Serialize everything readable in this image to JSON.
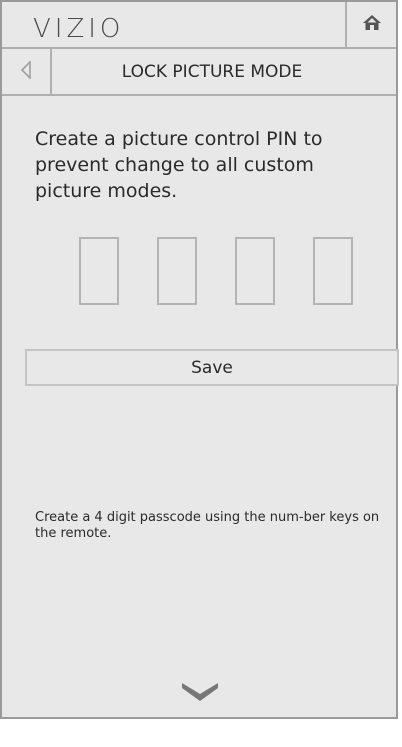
{
  "header": {
    "logo_text": "VIZIO",
    "home_icon": "home-icon"
  },
  "titlebar": {
    "back_icon": "back-arrow-icon",
    "title": "LOCK PICTURE MODE"
  },
  "main": {
    "description": "Create a picture control PIN to prevent change to all custom picture modes.",
    "pin_digits": [
      "",
      "",
      "",
      ""
    ],
    "save_label": "Save",
    "hint": "Create a 4 digit passcode using the num-ber keys on the remote."
  },
  "footer": {
    "scroll_icon": "chevron-down-icon"
  },
  "colors": {
    "panel_bg": "#e8e8e8",
    "border": "#9a9a9a",
    "text": "#2a2a2a"
  }
}
